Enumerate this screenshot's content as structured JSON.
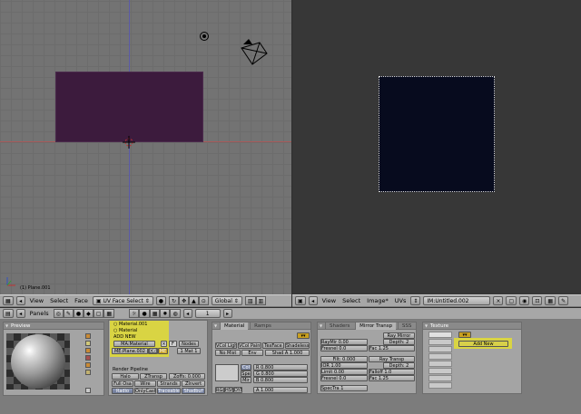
{
  "viewport3d": {
    "object_label": "(1) Plane.001"
  },
  "header3d": {
    "menus": [
      "View",
      "Select",
      "Face"
    ],
    "mode": "UV Face Select",
    "pivot": "Global"
  },
  "headerUV": {
    "menus": [
      "View",
      "Select",
      "Image*",
      "UVs"
    ],
    "image_name": "IM:Untitled.002"
  },
  "buttons_header": {
    "panels_label": "Panels",
    "frame": "1"
  },
  "preview_panel": {
    "title": "Preview"
  },
  "links_panel": {
    "material_menu": [
      "Material.001",
      "Material"
    ],
    "add_new": "ADD NEW",
    "ma_field": "MA:Material",
    "f_label": "F",
    "nodes": "Nodes",
    "me_field": "ME:Plane.002",
    "ob_label": "OB",
    "me_label": "ME",
    "mat_count": "1 Mat 1",
    "render_pipeline": "Render Pipeline",
    "pipeline_buttons": [
      "Halo",
      "ZTransp",
      "Zoffs: 0.000",
      "Full Osa",
      "Wire",
      "Strands",
      "ZInvert",
      "Radio",
      "OnlyCast",
      "Traceable",
      "Shadbuf"
    ]
  },
  "material_panel": {
    "tabs": [
      "Material",
      "Ramps"
    ],
    "row1": [
      "VCol Light",
      "VCol Paint",
      "TexFace",
      "Shadeless"
    ],
    "row2": [
      "No Mist",
      "Env",
      "Shad A 1.000"
    ],
    "color_labels": [
      "Col",
      "Spe",
      "Mir"
    ],
    "rgb_values": [
      "R 0.800",
      "G 0.800",
      "B 0.800"
    ],
    "modes": [
      "RGB",
      "HSV",
      "DYN"
    ],
    "alpha": "A 1.000"
  },
  "shaders_panel": {
    "tabs": [
      "Shaders",
      "Mirror Transp",
      "SSS"
    ],
    "ray_mirror": "Ray Mirror",
    "ray_mir": "RayMir 0.00",
    "depth1": "Depth: 2",
    "fresnel1": "Fresnel 0.0",
    "fac1": "Fac 1.25",
    "filt": "Filt: 0.000",
    "ray_transp": "Ray Transp",
    "ior": "IOR 1.00",
    "depth2": "Depth: 2",
    "limit": "Limit 0.00",
    "falloff": "Falloff 1.0",
    "fresnel2": "Fresnel 0.0",
    "fac2": "Fac 1.25",
    "spectra": "SpecTra 1"
  },
  "texture_panel": {
    "title": "Texture",
    "add_new": "Add New"
  },
  "colors": {
    "highlight": "#e8e228",
    "plane_purple": "#3c1b3d",
    "uv_image": "#070b1e"
  }
}
